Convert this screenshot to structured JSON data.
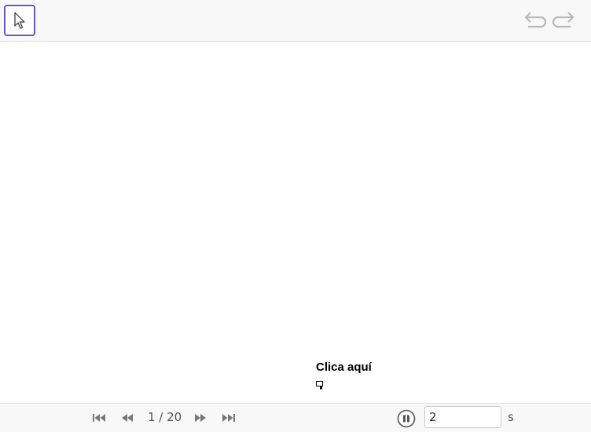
{
  "toolbar": {
    "tools": [
      {
        "icon": "pointer-arrow-icon",
        "selected": true
      }
    ],
    "undo_icon": "undo-icon",
    "redo_icon": "redo-icon"
  },
  "canvas": {
    "label": "Clica aquí",
    "checkbox_icon": "checkbox-icon"
  },
  "playbar": {
    "step_counter": "1 / 20",
    "speed_value": "2",
    "speed_unit": "s"
  },
  "colors": {
    "accent": "#6557d2",
    "toolbar_bg": "#f8f8f8",
    "icon_gray": "#9a9a9a"
  }
}
